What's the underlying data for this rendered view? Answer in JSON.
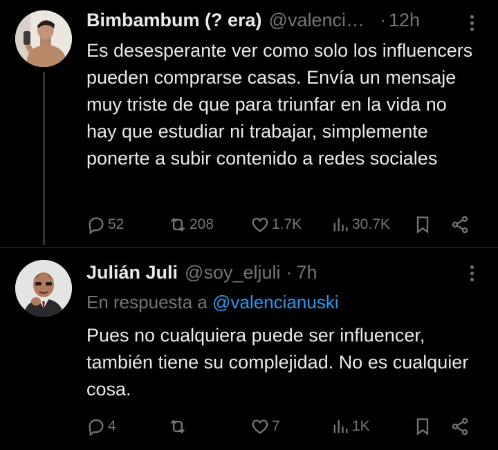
{
  "tweets": [
    {
      "name": "Bimbambum (? era)",
      "handle": "@valenci…",
      "separator": "·",
      "time": "12h",
      "text": "Es desesperante ver como solo los influencers pueden comprarse casas. Envía un mensaje muy triste de que para triunfar en la vida no hay que estudiar ni trabajar, simplemente ponerte a subir contenido a redes sociales",
      "replies": "52",
      "retweets": "208",
      "likes": "1.7K",
      "views": "30.7K"
    },
    {
      "name": "Julián Juli",
      "handle": "@soy_eljuli",
      "separator": "·",
      "time": "7h",
      "reply_prefix": "En respuesta a",
      "reply_mention": "@valencianuski",
      "text": "Pues no cualquiera puede ser influencer, también tiene su complejidad. No es cualquier cosa.",
      "replies": "4",
      "retweets": "",
      "likes": "7",
      "views": "1K"
    }
  ],
  "colors": {
    "background": "#000000",
    "text": "#e7e9ea",
    "muted": "#71767b",
    "link": "#1d9bf0",
    "thread_line": "#333639"
  },
  "icons": [
    "reply-icon",
    "retweet-icon",
    "like-icon",
    "views-icon",
    "bookmark-icon",
    "share-icon",
    "more-icon"
  ]
}
